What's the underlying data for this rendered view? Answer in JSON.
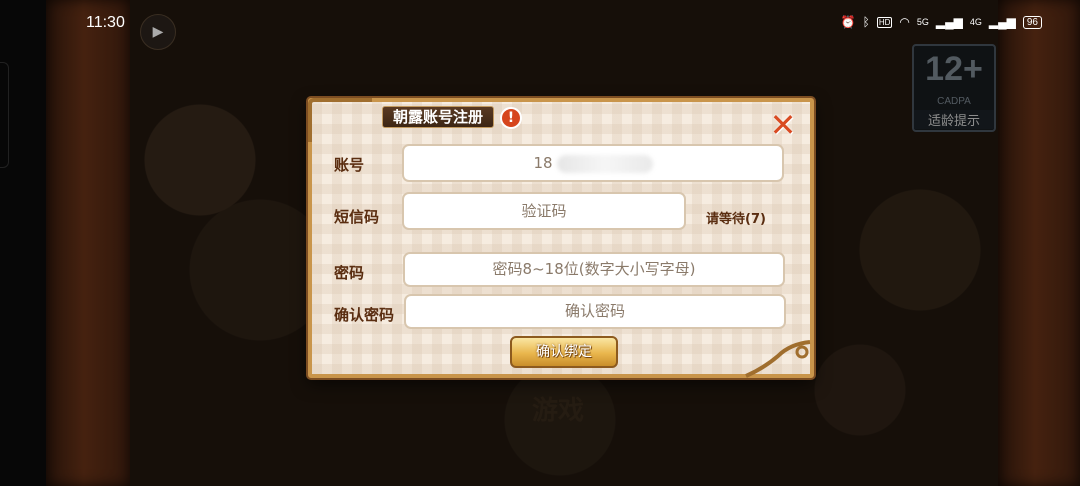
{
  "status_bar": {
    "time": "11:30",
    "icons": [
      "alarm-icon",
      "bluetooth-icon",
      "hd-icon",
      "wifi-icon"
    ],
    "signal_1": "5G",
    "signal_2": "4G",
    "battery": "96"
  },
  "background": {
    "age_rating": "12+",
    "age_org": "CADPA",
    "age_tip": "适龄提示",
    "game_text": "游戏"
  },
  "dialog": {
    "title": "朝露账号注册",
    "close_symbol": "✕",
    "account": {
      "label": "账号",
      "value_prefix": "18"
    },
    "sms": {
      "label": "短信码",
      "placeholder": "验证码",
      "wait_text": "请等待(7)"
    },
    "password": {
      "label": "密码",
      "placeholder": "密码8~18位(数字大小写字母)"
    },
    "confirm_password": {
      "label": "确认密码",
      "placeholder": "确认密码"
    },
    "submit_label": "确认绑定"
  },
  "colors": {
    "dialog_border": "#c9954b",
    "label_text": "#5a2d10",
    "close_icon": "#d94b22",
    "button_gold": "#e9b64d"
  }
}
